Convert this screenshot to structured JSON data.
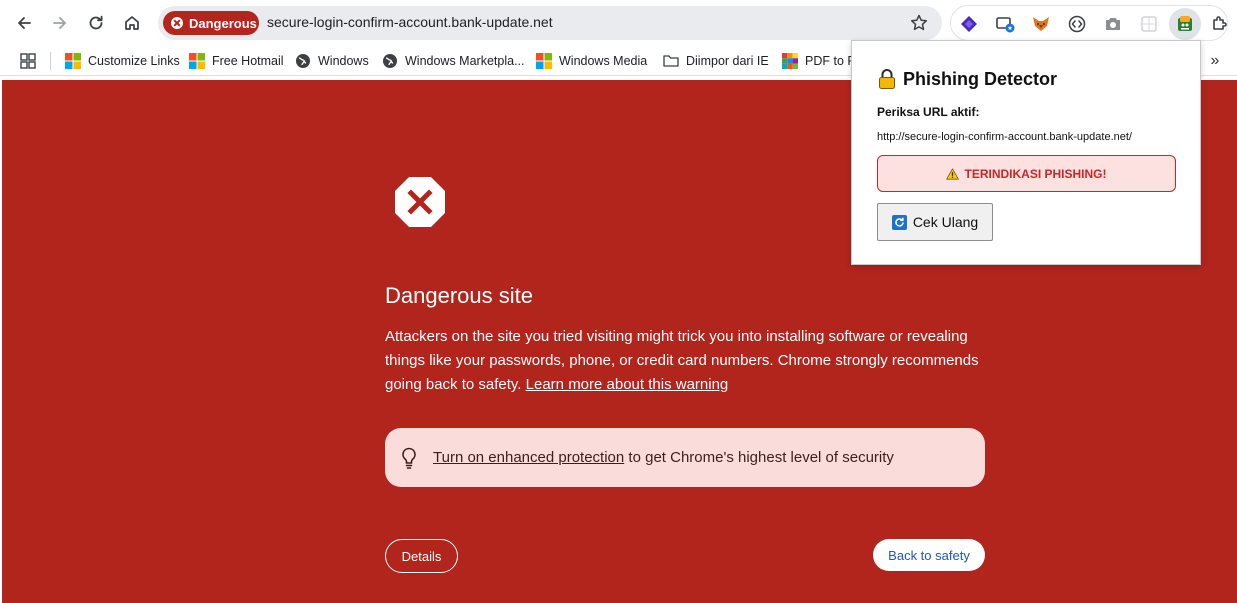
{
  "browser": {
    "security_chip_label": "Dangerous",
    "url": "secure-login-confirm-account.bank-update.net"
  },
  "bookmarks": [
    {
      "label": "Customize Links",
      "icon": "windows-logo-icon"
    },
    {
      "label": "Free Hotmail",
      "icon": "windows-logo-icon"
    },
    {
      "label": "Windows",
      "icon": "globe-icon"
    },
    {
      "label": "Windows Marketpla...",
      "icon": "globe-icon"
    },
    {
      "label": "Windows Media",
      "icon": "windows-logo-icon"
    },
    {
      "label": "Diimpor dari IE",
      "icon": "folder-icon"
    },
    {
      "label": "PDF to P",
      "icon": "pdf-tool-icon"
    }
  ],
  "interstitial": {
    "heading": "Dangerous site",
    "body": "Attackers on the site you tried visiting might trick you into installing software or revealing things like your passwords, phone, or credit card numbers. Chrome strongly recommends going back to safety.",
    "learn_more": "Learn more about this warning",
    "protection_link": "Turn on enhanced protection",
    "protection_text": "to get Chrome's highest level of security",
    "details_button": "Details",
    "back_button": "Back to safety",
    "background_color": "#b1251d"
  },
  "popup": {
    "title": "Phishing Detector",
    "label": "Periksa URL aktif:",
    "url": "http://secure-login-confirm-account.bank-update.net/",
    "alert": "TERINDIKASI PHISHING!",
    "recheck_button": "Cek Ulang",
    "alert_color": "#c62828"
  }
}
